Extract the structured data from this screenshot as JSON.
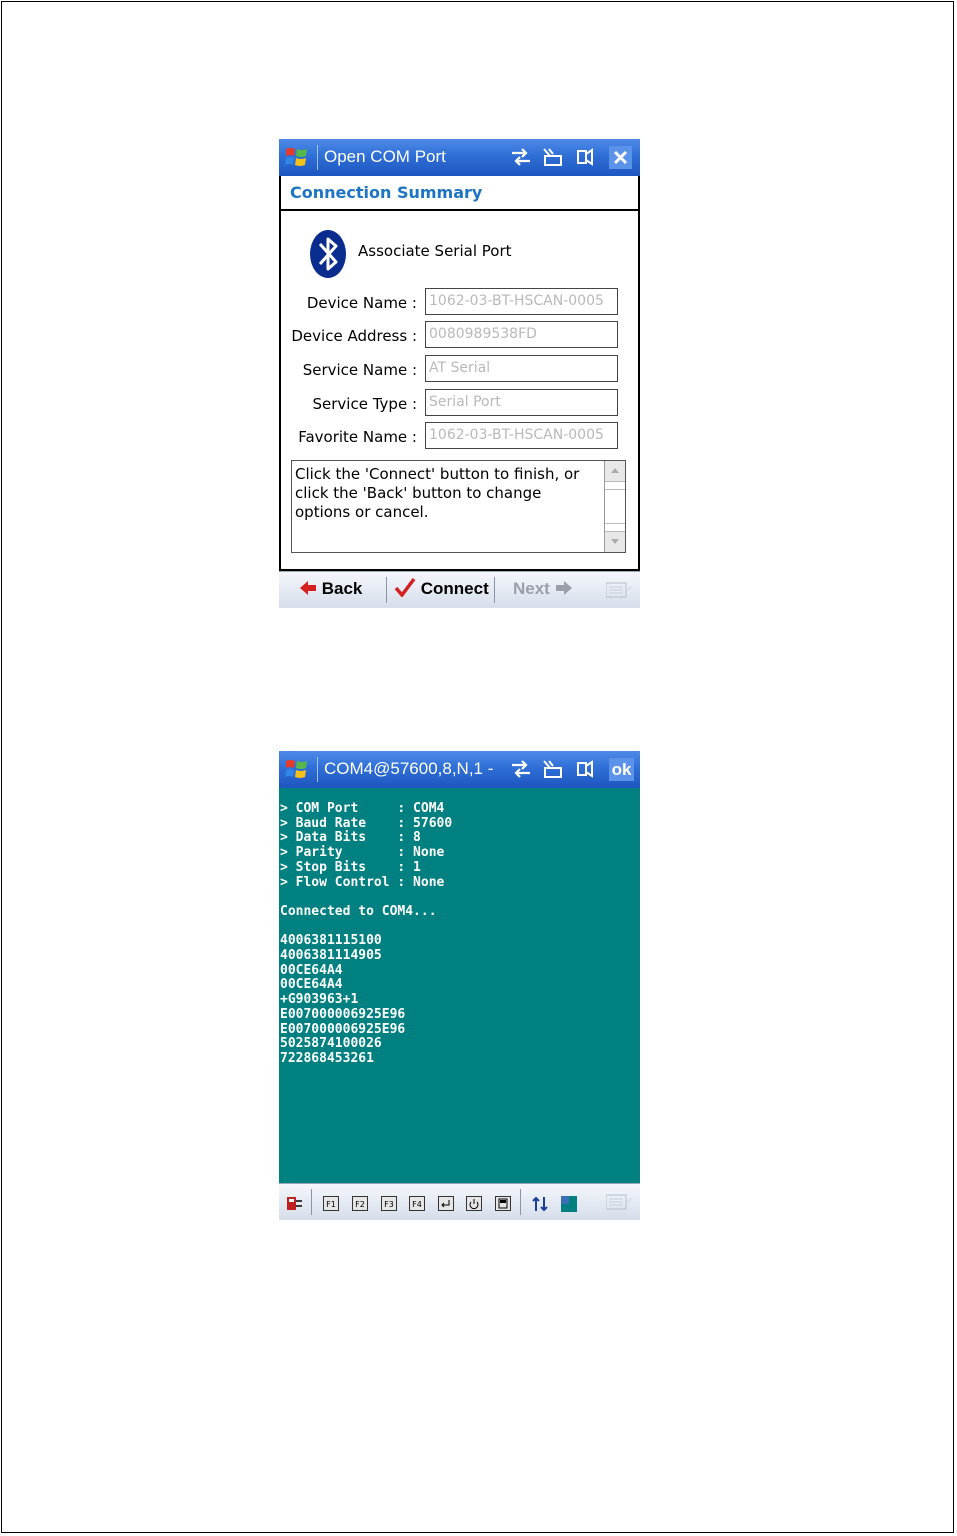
{
  "screen1": {
    "title": "Open COM Port",
    "heading": "Connection Summary",
    "associate_label": "Associate Serial Port",
    "fields": [
      {
        "label": "Device Name :",
        "value": "1062-03-BT-HSCAN-0005"
      },
      {
        "label": "Device Address :",
        "value": "0080989538FD"
      },
      {
        "label": "Service Name :",
        "value": "AT Serial"
      },
      {
        "label": "Service Type :",
        "value": "Serial Port"
      },
      {
        "label": "Favorite Name :",
        "value": "1062-03-BT-HSCAN-0005"
      }
    ],
    "message": "Click the 'Connect' button to finish, or click the 'Back' button to change options or cancel.",
    "menu": {
      "back": "Back",
      "connect": "Connect",
      "next": "Next"
    }
  },
  "screen2": {
    "title": "COM4@57600,8,N,1 -",
    "ok": "ok",
    "settings": [
      "> COM Port     : COM4",
      "> Baud Rate    : 57600",
      "> Data Bits    : 8",
      "> Parity       : None",
      "> Stop Bits    : 1",
      "> Flow Control : None"
    ],
    "status": "Connected to COM4...",
    "readings": [
      "4006381115100",
      "4006381114905",
      "00CE64A4",
      "00CE64A4",
      "+G903963+1",
      "E007000006925E96",
      "E007000006925E96",
      "5025874100026",
      "722868453261"
    ],
    "toolbar": {
      "f1": "F1",
      "f2": "F2",
      "f3": "F3",
      "f4": "F4"
    }
  },
  "colors": {
    "titlebar": "#2f6fd6",
    "heading": "#1c74c4",
    "console_bg": "#008080",
    "disabled_text": "#b9b9b9"
  }
}
